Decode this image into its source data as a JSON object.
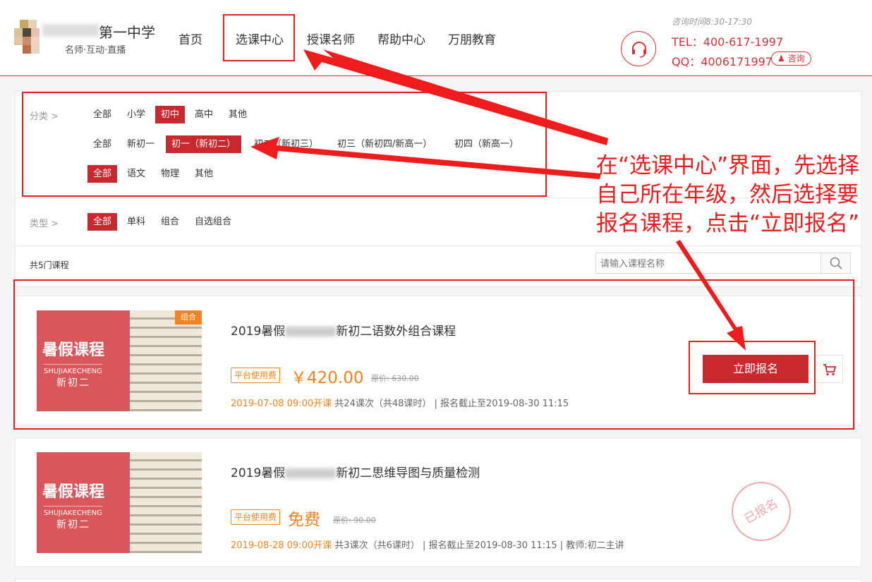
{
  "header": {
    "logo_title": "第一中学",
    "logo_sub": "名师·互动·直播",
    "nav": [
      "首页",
      "选课中心",
      "授课名师",
      "帮助中心",
      "万朋教育"
    ],
    "hours": "咨询时间8:30-17:30",
    "tel": "TEL：400-617-1997",
    "qq": "QQ：4006171997",
    "qq_badge": "咨询",
    "icon": "headset-icon"
  },
  "filters": {
    "category_label": "分类 >",
    "levels": [
      "全部",
      "小学",
      "初中",
      "高中",
      "其他"
    ],
    "grades": [
      "全部",
      "新初一",
      "初一（新初二）",
      "初二（新初三）",
      "初三（新初四/新高一）",
      "初四（新高一）"
    ],
    "subjects": [
      "全部",
      "语文",
      "物理",
      "其他"
    ],
    "type_label": "类型 >",
    "types": [
      "全部",
      "单科",
      "组合",
      "自选组合"
    ]
  },
  "list": {
    "count": "共5门课程",
    "search_placeholder": "请输入课程名称",
    "search_icon": "search-icon"
  },
  "courses": [
    {
      "thumb_title": "暑假课程",
      "thumb_pinyin": "SHUJIAKECHENG",
      "thumb_grade": "新初二",
      "tag": "组合",
      "title_prefix": "2019暑假",
      "title_suffix": "新初二语数外组合课程",
      "fee_badge": "平台使用费",
      "price": "￥420.00",
      "original": "原价: 630.00",
      "start": "2019-07-08 09:00开课",
      "info": "共24课次（共48课时） | 报名截止至2019-08-30 11:15",
      "enroll": "立即报名",
      "cart_icon": "cart-icon"
    },
    {
      "thumb_title": "暑假课程",
      "thumb_pinyin": "SHUJIAKECHENG",
      "thumb_grade": "新初二",
      "title_prefix": "2019暑假",
      "title_suffix": "新初二思维导图与质量检测",
      "fee_badge": "平台使用费",
      "price": "免费",
      "original": "原价: 90.00",
      "start": "2019-08-28 09:00开课",
      "info": "共3课次（共6课时） | 报名截止至2019-08-30 11:15 | 教师:初二主讲",
      "stamp": "已报名"
    }
  ],
  "annotation": {
    "text": "在“选课中心”界面，先选择自己所在年级，然后选择要报名课程，点击“立即报名”"
  },
  "colors": {
    "accent": "#c9282e",
    "orange": "#f58220",
    "annotation": "#ee1c1c"
  }
}
